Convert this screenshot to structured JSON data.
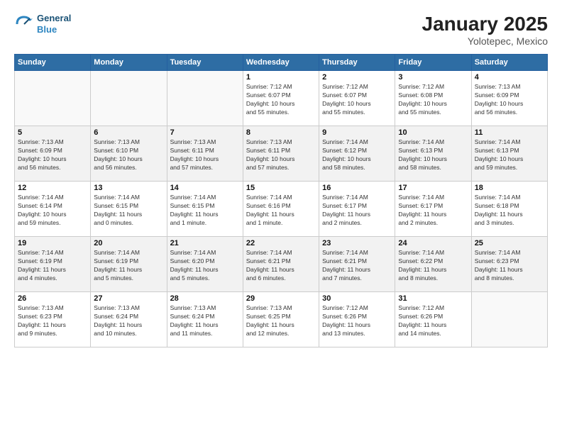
{
  "header": {
    "logo_line1": "General",
    "logo_line2": "Blue",
    "title": "January 2025",
    "location": "Yolotepec, Mexico"
  },
  "days_of_week": [
    "Sunday",
    "Monday",
    "Tuesday",
    "Wednesday",
    "Thursday",
    "Friday",
    "Saturday"
  ],
  "weeks": [
    [
      {
        "day": "",
        "detail": ""
      },
      {
        "day": "",
        "detail": ""
      },
      {
        "day": "",
        "detail": ""
      },
      {
        "day": "1",
        "detail": "Sunrise: 7:12 AM\nSunset: 6:07 PM\nDaylight: 10 hours\nand 55 minutes."
      },
      {
        "day": "2",
        "detail": "Sunrise: 7:12 AM\nSunset: 6:07 PM\nDaylight: 10 hours\nand 55 minutes."
      },
      {
        "day": "3",
        "detail": "Sunrise: 7:12 AM\nSunset: 6:08 PM\nDaylight: 10 hours\nand 55 minutes."
      },
      {
        "day": "4",
        "detail": "Sunrise: 7:13 AM\nSunset: 6:09 PM\nDaylight: 10 hours\nand 56 minutes."
      }
    ],
    [
      {
        "day": "5",
        "detail": "Sunrise: 7:13 AM\nSunset: 6:09 PM\nDaylight: 10 hours\nand 56 minutes."
      },
      {
        "day": "6",
        "detail": "Sunrise: 7:13 AM\nSunset: 6:10 PM\nDaylight: 10 hours\nand 56 minutes."
      },
      {
        "day": "7",
        "detail": "Sunrise: 7:13 AM\nSunset: 6:11 PM\nDaylight: 10 hours\nand 57 minutes."
      },
      {
        "day": "8",
        "detail": "Sunrise: 7:13 AM\nSunset: 6:11 PM\nDaylight: 10 hours\nand 57 minutes."
      },
      {
        "day": "9",
        "detail": "Sunrise: 7:14 AM\nSunset: 6:12 PM\nDaylight: 10 hours\nand 58 minutes."
      },
      {
        "day": "10",
        "detail": "Sunrise: 7:14 AM\nSunset: 6:13 PM\nDaylight: 10 hours\nand 58 minutes."
      },
      {
        "day": "11",
        "detail": "Sunrise: 7:14 AM\nSunset: 6:13 PM\nDaylight: 10 hours\nand 59 minutes."
      }
    ],
    [
      {
        "day": "12",
        "detail": "Sunrise: 7:14 AM\nSunset: 6:14 PM\nDaylight: 10 hours\nand 59 minutes."
      },
      {
        "day": "13",
        "detail": "Sunrise: 7:14 AM\nSunset: 6:15 PM\nDaylight: 11 hours\nand 0 minutes."
      },
      {
        "day": "14",
        "detail": "Sunrise: 7:14 AM\nSunset: 6:15 PM\nDaylight: 11 hours\nand 1 minute."
      },
      {
        "day": "15",
        "detail": "Sunrise: 7:14 AM\nSunset: 6:16 PM\nDaylight: 11 hours\nand 1 minute."
      },
      {
        "day": "16",
        "detail": "Sunrise: 7:14 AM\nSunset: 6:17 PM\nDaylight: 11 hours\nand 2 minutes."
      },
      {
        "day": "17",
        "detail": "Sunrise: 7:14 AM\nSunset: 6:17 PM\nDaylight: 11 hours\nand 2 minutes."
      },
      {
        "day": "18",
        "detail": "Sunrise: 7:14 AM\nSunset: 6:18 PM\nDaylight: 11 hours\nand 3 minutes."
      }
    ],
    [
      {
        "day": "19",
        "detail": "Sunrise: 7:14 AM\nSunset: 6:19 PM\nDaylight: 11 hours\nand 4 minutes."
      },
      {
        "day": "20",
        "detail": "Sunrise: 7:14 AM\nSunset: 6:19 PM\nDaylight: 11 hours\nand 5 minutes."
      },
      {
        "day": "21",
        "detail": "Sunrise: 7:14 AM\nSunset: 6:20 PM\nDaylight: 11 hours\nand 5 minutes."
      },
      {
        "day": "22",
        "detail": "Sunrise: 7:14 AM\nSunset: 6:21 PM\nDaylight: 11 hours\nand 6 minutes."
      },
      {
        "day": "23",
        "detail": "Sunrise: 7:14 AM\nSunset: 6:21 PM\nDaylight: 11 hours\nand 7 minutes."
      },
      {
        "day": "24",
        "detail": "Sunrise: 7:14 AM\nSunset: 6:22 PM\nDaylight: 11 hours\nand 8 minutes."
      },
      {
        "day": "25",
        "detail": "Sunrise: 7:14 AM\nSunset: 6:23 PM\nDaylight: 11 hours\nand 8 minutes."
      }
    ],
    [
      {
        "day": "26",
        "detail": "Sunrise: 7:13 AM\nSunset: 6:23 PM\nDaylight: 11 hours\nand 9 minutes."
      },
      {
        "day": "27",
        "detail": "Sunrise: 7:13 AM\nSunset: 6:24 PM\nDaylight: 11 hours\nand 10 minutes."
      },
      {
        "day": "28",
        "detail": "Sunrise: 7:13 AM\nSunset: 6:24 PM\nDaylight: 11 hours\nand 11 minutes."
      },
      {
        "day": "29",
        "detail": "Sunrise: 7:13 AM\nSunset: 6:25 PM\nDaylight: 11 hours\nand 12 minutes."
      },
      {
        "day": "30",
        "detail": "Sunrise: 7:12 AM\nSunset: 6:26 PM\nDaylight: 11 hours\nand 13 minutes."
      },
      {
        "day": "31",
        "detail": "Sunrise: 7:12 AM\nSunset: 6:26 PM\nDaylight: 11 hours\nand 14 minutes."
      },
      {
        "day": "",
        "detail": ""
      }
    ]
  ]
}
